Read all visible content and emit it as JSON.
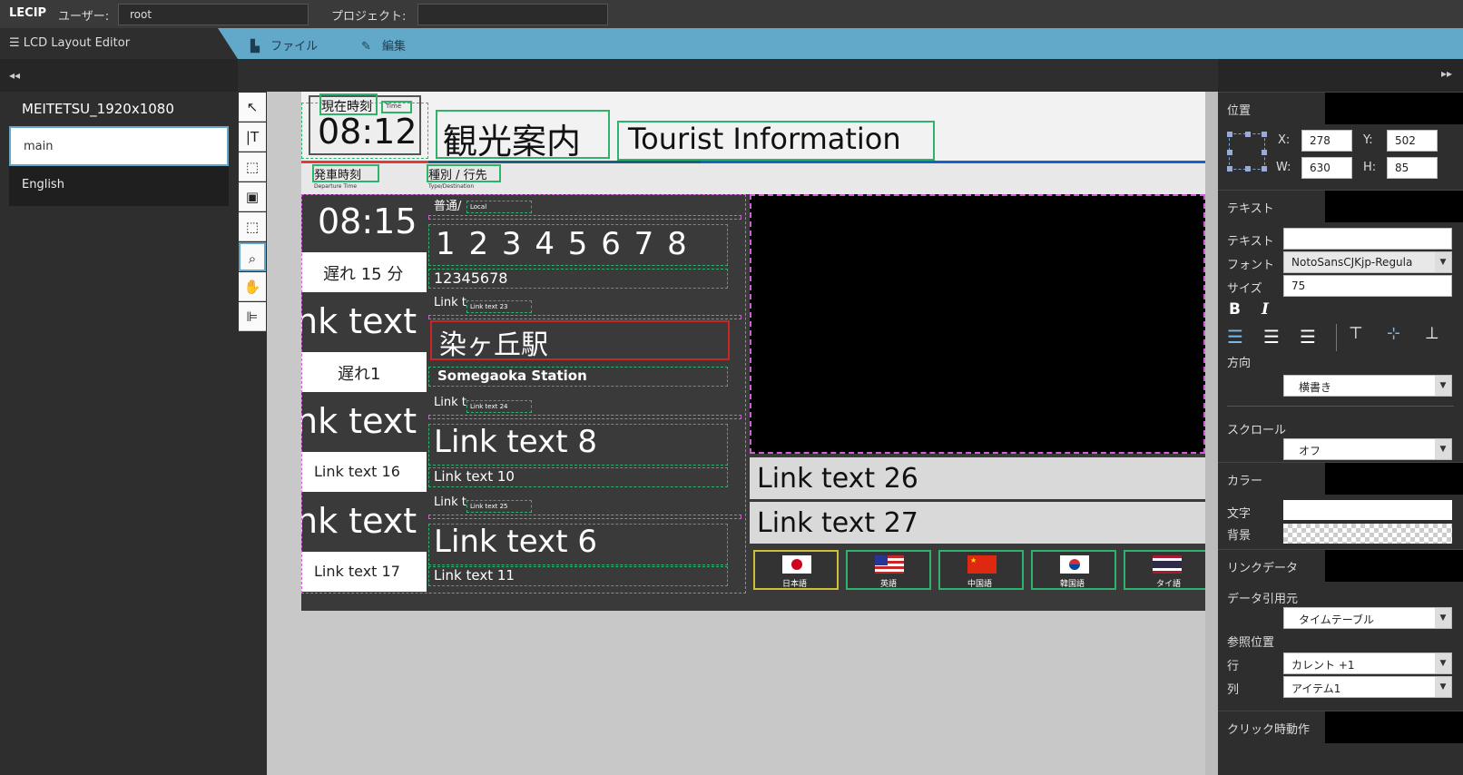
{
  "topbar": {
    "brand": "LECIP",
    "user_label": "ユーザー:",
    "user_value": "root",
    "project_label": "プロジェクト:",
    "project_value": ""
  },
  "menubar": {
    "app_name": "LCD Layout Editor",
    "file_menu": "ファイル",
    "edit_menu": "編集"
  },
  "left_panel": {
    "collapse_glyph": "◂◂",
    "project": "MEITETSU_1920x1080",
    "layouts": [
      "main",
      "English"
    ]
  },
  "canvas": {
    "now_label": "現在時刻",
    "now_sub": "Time",
    "now_time": "08:12",
    "title_jp": "観光案内",
    "title_en": "Tourist Information",
    "depart_label": "発車時刻",
    "depart_sub": "Departure Time",
    "type_label": "種別 / 行先",
    "type_sub": "Type/Destination",
    "rows": [
      {
        "time": "08:15",
        "status": "遅れ 15 分",
        "type_small": "普通/",
        "type_tiny": "Local",
        "dest_big": "1 2 3 4 5 6 7 8",
        "dest_sub": "12345678"
      },
      {
        "time": "nk text",
        "status": "遅れ1",
        "type_small": "Link t",
        "type_tiny": "Link text 23",
        "dest_big": "染ヶ丘駅",
        "dest_sub": "Somegaoka Station"
      },
      {
        "time": "nk text",
        "status": "Link text 16",
        "type_small": "Link t",
        "type_tiny": "Link text 24",
        "dest_big": "Link text 8",
        "dest_sub": "Link text 10"
      },
      {
        "time": "nk text",
        "status": "Link text 17",
        "type_small": "Link t",
        "type_tiny": "Link text 25",
        "dest_big": "Link text 6",
        "dest_sub": "Link text 11"
      }
    ],
    "info_lines": [
      "Link text 26",
      "Link text 27"
    ],
    "languages": [
      {
        "label": "日本語",
        "flag": "jp"
      },
      {
        "label": "英語",
        "flag": "us"
      },
      {
        "label": "中国語",
        "flag": "cn"
      },
      {
        "label": "韓国語",
        "flag": "kr"
      },
      {
        "label": "タイ語",
        "flag": "th"
      }
    ]
  },
  "right_panel": {
    "expand_glyph": "▸▸",
    "position": {
      "title": "位置",
      "x_label": "X:",
      "x": "278",
      "y_label": "Y:",
      "y": "502",
      "w_label": "W:",
      "w": "630",
      "h_label": "H:",
      "h": "85"
    },
    "text": {
      "title": "テキスト",
      "text_label": "テキスト",
      "text_value": "",
      "font_label": "フォント",
      "font_value": "NotoSansCJKjp-Regula",
      "size_label": "サイズ",
      "size_value": "75",
      "bold": "B",
      "italic": "I",
      "direction_label": "方向",
      "direction_value": "横書き",
      "scroll_label": "スクロール",
      "scroll_value": "オフ"
    },
    "color": {
      "title": "カラー",
      "text_label": "文字",
      "bg_label": "背景"
    },
    "link": {
      "title": "リンクデータ",
      "source_label": "データ引用元",
      "source_value": "タイムテーブル",
      "ref_label": "参照位置",
      "row_label": "行",
      "row_value": "カレント +1",
      "col_label": "列",
      "col_value": "アイテム1"
    },
    "click": {
      "title": "クリック時動作"
    }
  }
}
